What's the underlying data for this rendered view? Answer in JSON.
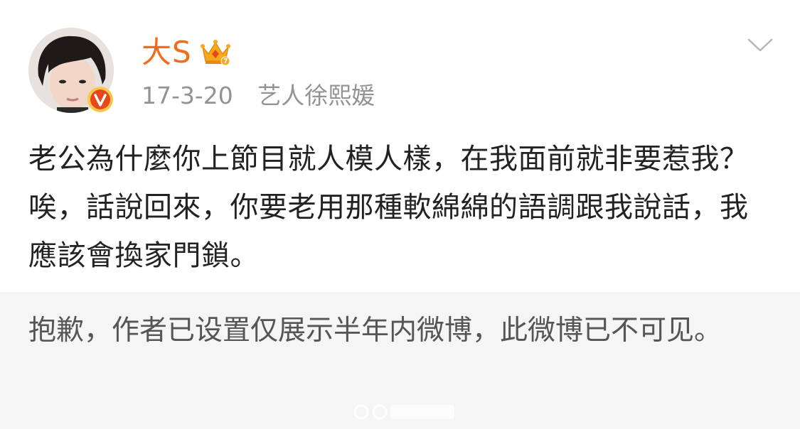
{
  "post": {
    "author": {
      "name": "大S",
      "avatar_icon": "avatar-photo",
      "verified_icon": "verified-v-badge",
      "level_icon": "vip-crown-icon"
    },
    "meta": {
      "date": "17-3-20",
      "source": "艺人徐熙媛"
    },
    "menu_icon": "chevron-down-icon",
    "content_text": "老公為什麼你上節目就人模人樣，在我面前就非要惹我？唉，話說回來，你要老用那種軟綿綿的語調跟我說話，我應該會換家門鎖。",
    "notice_text": "抱歉，作者已设置仅展示半年内微博，此微博已不可见。"
  },
  "colors": {
    "username": "#f36b1c",
    "meta_text": "#939393",
    "content_text": "#222222",
    "notice_bg": "#f5f5f5",
    "notice_text": "#555555",
    "badge": "#e8471e",
    "crown": "#f7a81b"
  }
}
